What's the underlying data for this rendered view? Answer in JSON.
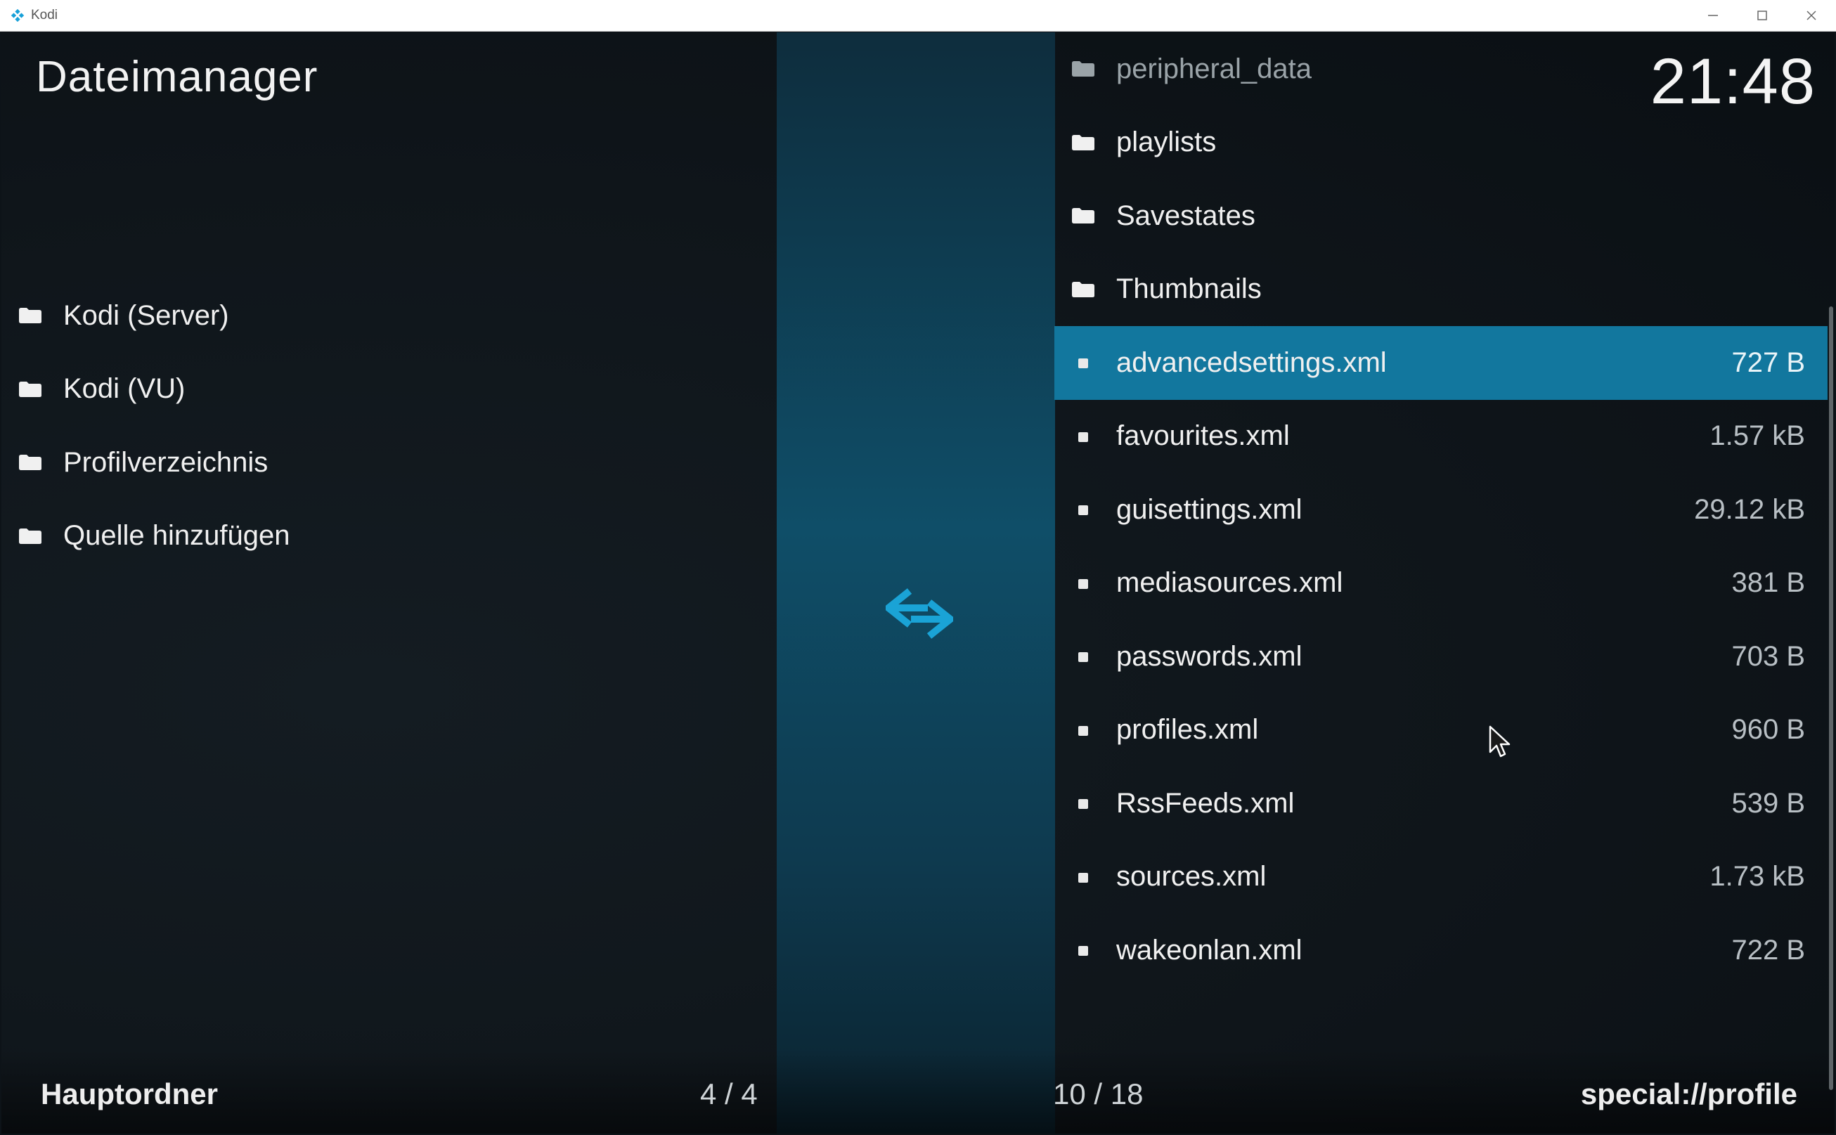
{
  "window": {
    "title": "Kodi",
    "minimize_icon": "minimize-icon",
    "maximize_icon": "maximize-icon",
    "close_icon": "close-icon"
  },
  "header": {
    "title": "Dateimanager",
    "clock": "21:48"
  },
  "left_panel": {
    "items": [
      {
        "label": "Kodi (Server)",
        "icon": "folder-icon"
      },
      {
        "label": "Kodi (VU)",
        "icon": "folder-icon"
      },
      {
        "label": "Profilverzeichnis",
        "icon": "folder-icon"
      },
      {
        "label": "Quelle hinzufügen",
        "icon": "folder-icon"
      }
    ],
    "footer_label": "Hauptordner",
    "count": "4 / 4"
  },
  "swap_icon": "swap-arrows-icon",
  "right_panel": {
    "items": [
      {
        "label": "peripheral_data",
        "size": "",
        "type": "folder"
      },
      {
        "label": "playlists",
        "size": "",
        "type": "folder"
      },
      {
        "label": "Savestates",
        "size": "",
        "type": "folder"
      },
      {
        "label": "Thumbnails",
        "size": "",
        "type": "folder"
      },
      {
        "label": "advancedsettings.xml",
        "size": "727 B",
        "type": "file",
        "selected": true
      },
      {
        "label": "favourites.xml",
        "size": "1.57 kB",
        "type": "file"
      },
      {
        "label": "guisettings.xml",
        "size": "29.12 kB",
        "type": "file"
      },
      {
        "label": "mediasources.xml",
        "size": "381 B",
        "type": "file"
      },
      {
        "label": "passwords.xml",
        "size": "703 B",
        "type": "file"
      },
      {
        "label": "profiles.xml",
        "size": "960 B",
        "type": "file"
      },
      {
        "label": "RssFeeds.xml",
        "size": "539 B",
        "type": "file"
      },
      {
        "label": "sources.xml",
        "size": "1.73 kB",
        "type": "file"
      },
      {
        "label": "wakeonlan.xml",
        "size": "722 B",
        "type": "file"
      }
    ],
    "count": "10 / 18",
    "path": "special://profile"
  },
  "colors": {
    "selection": "#12779e",
    "accent": "#1aa3d6"
  }
}
